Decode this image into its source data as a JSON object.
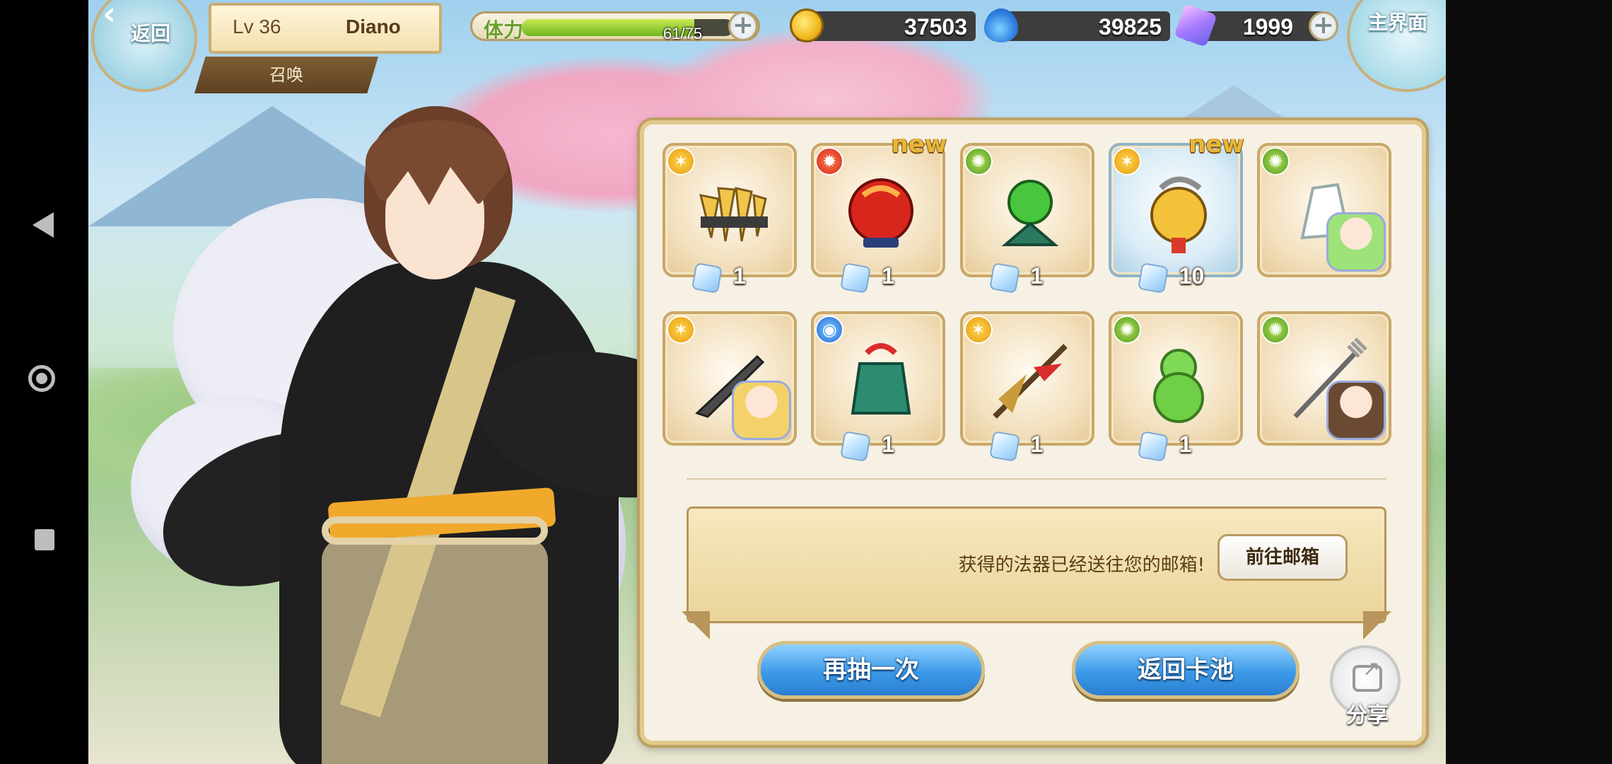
{
  "header": {
    "back_label": "返回",
    "level": "Lv 36",
    "player_name": "Diano",
    "subtitle": "召唤",
    "stamina": {
      "label": "体力",
      "text": "61/75",
      "current": 61,
      "max": 75
    },
    "gold": "37503",
    "water": "39825",
    "crystal": "1999",
    "main_label": "主界面"
  },
  "items": [
    {
      "name": "golden-claw-item",
      "element": "gold",
      "qty": "1",
      "new": false,
      "frame": "gold"
    },
    {
      "name": "red-orb-item",
      "element": "red",
      "qty": "1",
      "new": true,
      "new_label": "new",
      "frame": "gold"
    },
    {
      "name": "green-orb-item",
      "element": "green",
      "qty": "1",
      "new": false,
      "frame": "gold"
    },
    {
      "name": "golden-bell-item",
      "element": "gold",
      "qty": "10",
      "new": true,
      "new_label": "new",
      "frame": "blue"
    },
    {
      "name": "glove-portrait-item",
      "element": "green",
      "qty": "",
      "new": false,
      "frame": "gold"
    },
    {
      "name": "knife-portrait-item",
      "element": "gold",
      "qty": "",
      "new": false,
      "frame": "gold"
    },
    {
      "name": "green-bell-item",
      "element": "blue",
      "qty": "1",
      "new": false,
      "frame": "gold"
    },
    {
      "name": "red-spear-item",
      "element": "gold",
      "qty": "1",
      "new": false,
      "frame": "gold"
    },
    {
      "name": "green-gourd-item",
      "element": "green",
      "qty": "1",
      "new": false,
      "frame": "gold"
    },
    {
      "name": "trident-portrait-item",
      "element": "green",
      "qty": "",
      "new": false,
      "frame": "gold"
    }
  ],
  "notice": {
    "message": "获得的法器已经送往您的邮箱!",
    "mail_button": "前往邮箱"
  },
  "actions": {
    "draw_again": "再抽一次",
    "return_pool": "返回卡池",
    "share": "分享"
  },
  "colors": {
    "accent_gold": "#c9a869",
    "button_blue": "#3d9ae8",
    "panel_bg": "#f6f1e4"
  }
}
